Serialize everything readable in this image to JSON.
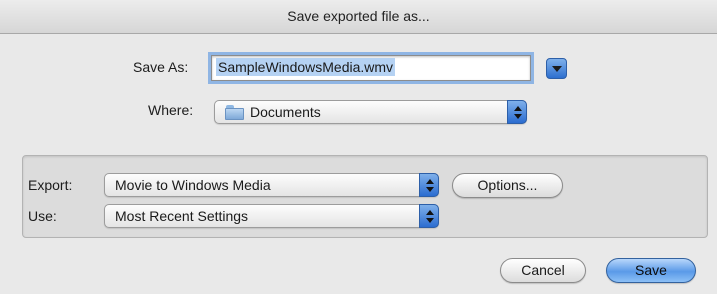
{
  "window": {
    "title": "Save exported file as..."
  },
  "save_as": {
    "label": "Save As:",
    "value": "SampleWindowsMedia.wmv"
  },
  "where": {
    "label": "Where:",
    "value": "Documents",
    "icon": "folder-icon"
  },
  "export": {
    "label": "Export:",
    "value": "Movie to Windows Media",
    "options_label": "Options..."
  },
  "use": {
    "label": "Use:",
    "value": "Most Recent Settings"
  },
  "buttons": {
    "cancel": "Cancel",
    "save": "Save"
  },
  "colors": {
    "accent": "#2d6fcf",
    "focus_ring": "#8fb5e4",
    "selection": "#b5d2f3"
  }
}
